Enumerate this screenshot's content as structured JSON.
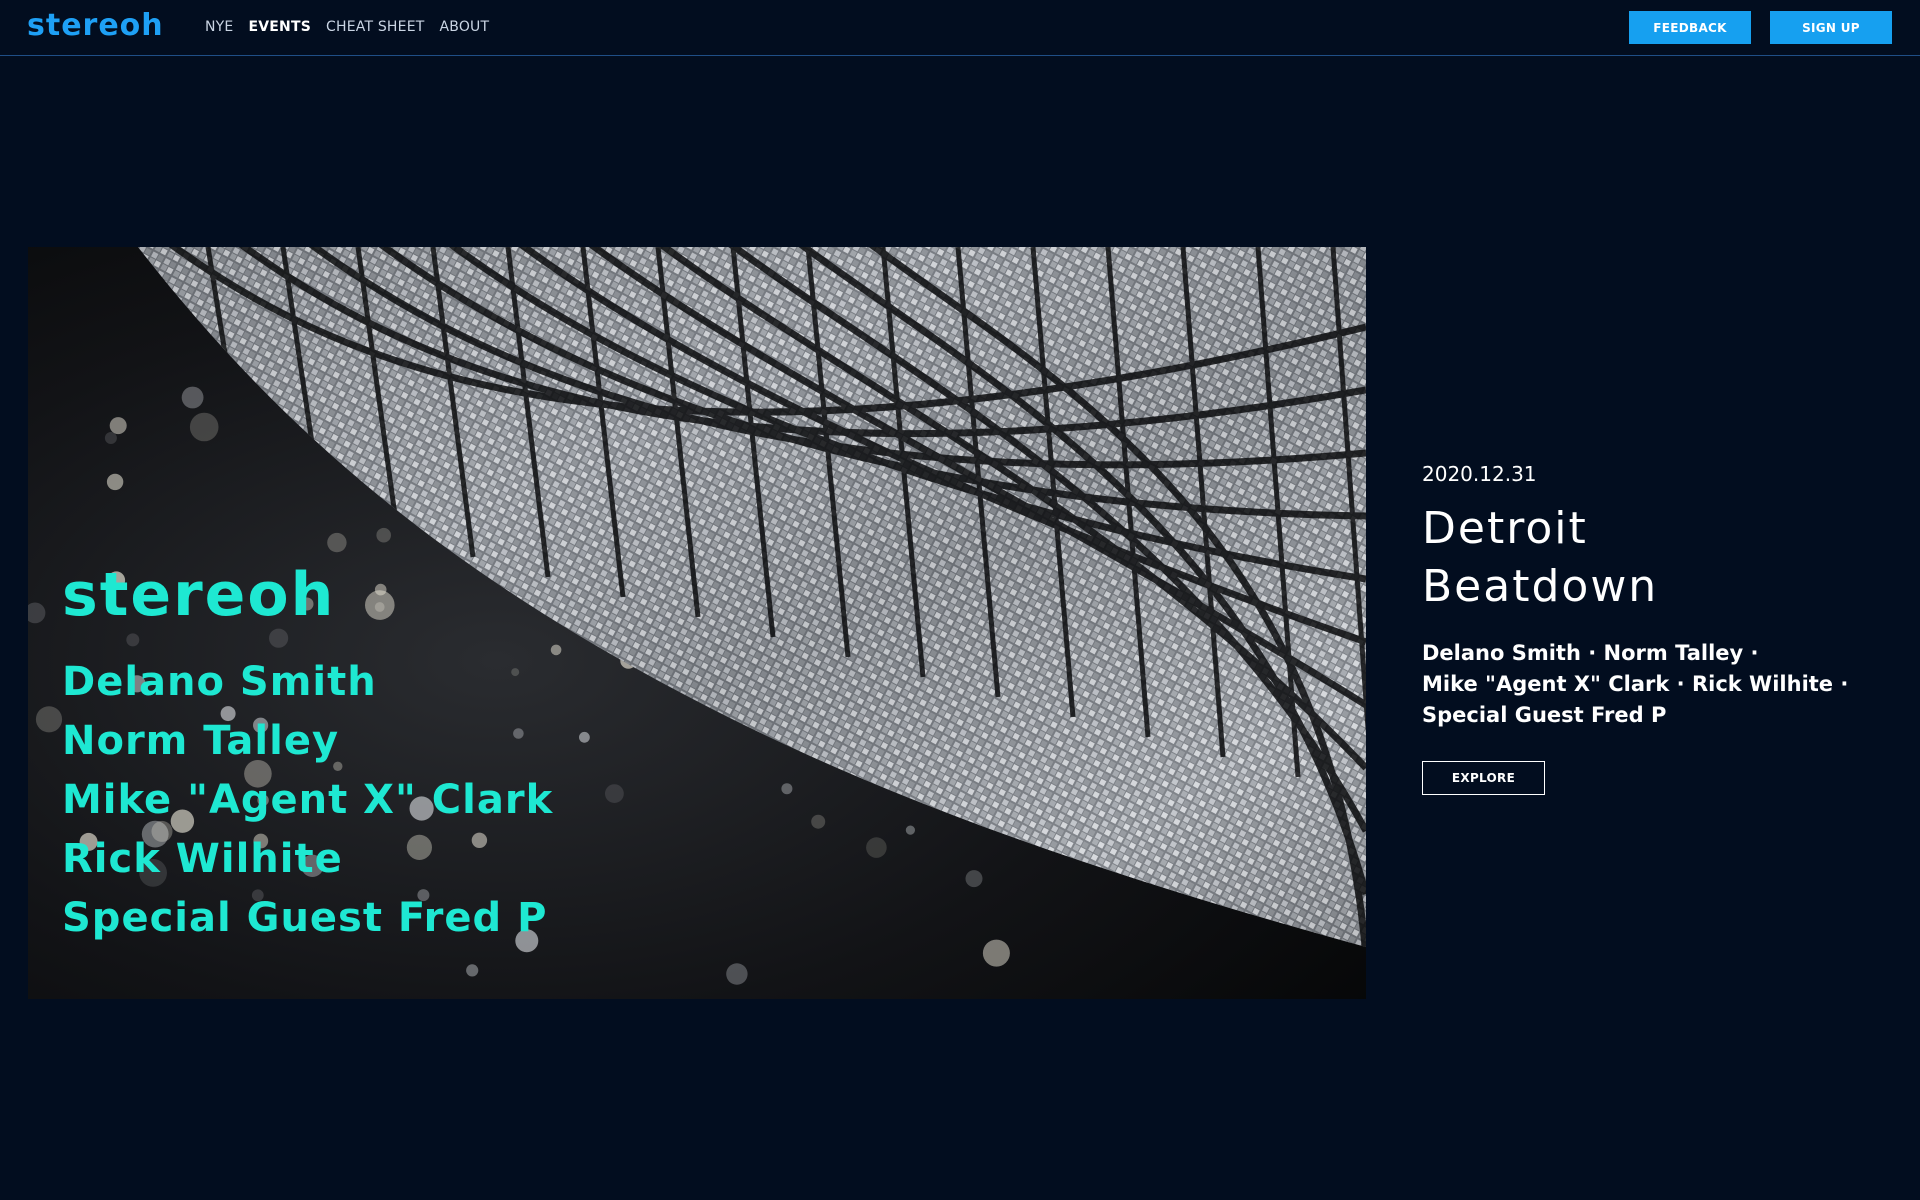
{
  "brand": {
    "name": "stereoh",
    "color": "#1ea0f5"
  },
  "nav": {
    "items": [
      {
        "label": "NYE",
        "active": false
      },
      {
        "label": "EVENTS",
        "active": true
      },
      {
        "label": "CHEAT SHEET",
        "active": false
      },
      {
        "label": "ABOUT",
        "active": false
      }
    ]
  },
  "header_actions": {
    "feedback_label": "FEEDBACK",
    "signup_label": "SIGN UP",
    "button_color": "#16a0f0"
  },
  "hero": {
    "image_description_icon": "disco-ball-image",
    "brand": "stereoh",
    "artists": [
      "Delano Smith",
      "Norm Talley",
      "Mike \"Agent X\" Clark",
      "Rick Wilhite",
      "Special Guest Fred P"
    ],
    "text_color": "#1ee8d2"
  },
  "event": {
    "date": "2020.12.31",
    "title_line1": "Detroit",
    "title_line2": "Beatdown",
    "lineup_line1": "Delano Smith · Norm Talley ·",
    "lineup_line2": "Mike \"Agent X\" Clark · Rick Wilhite ·",
    "lineup_line3": "Special Guest Fred P",
    "explore_label": "EXPLORE"
  },
  "colors": {
    "background": "#020d1f",
    "divider": "#1f4e86"
  }
}
